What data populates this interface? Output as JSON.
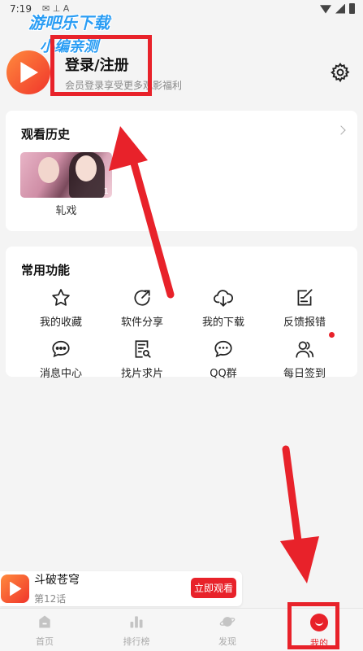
{
  "status_bar": {
    "time": "7:19",
    "icons": "✉ ⊥ A"
  },
  "watermark": {
    "line1": "游吧乐下载",
    "line2": "小编亲测"
  },
  "profile": {
    "login_title": "登录/注册",
    "login_subtitle": "会员登录享受更多观影福利"
  },
  "history": {
    "title": "观看历史",
    "items": [
      {
        "name": "轧戏",
        "episode": "1"
      }
    ]
  },
  "functions": {
    "title": "常用功能",
    "items": [
      {
        "label": "我的收藏",
        "icon": "star-icon"
      },
      {
        "label": "软件分享",
        "icon": "share-icon"
      },
      {
        "label": "我的下载",
        "icon": "cloud-download-icon"
      },
      {
        "label": "反馈报错",
        "icon": "edit-icon"
      },
      {
        "label": "消息中心",
        "icon": "message-icon"
      },
      {
        "label": "找片求片",
        "icon": "search-doc-icon"
      },
      {
        "label": "QQ群",
        "icon": "chat-icon"
      },
      {
        "label": "每日签到",
        "icon": "users-icon"
      }
    ]
  },
  "mini_player": {
    "title": "斗破苍穹",
    "episode": "第12话",
    "button": "立即观看"
  },
  "tabs": [
    {
      "label": "首页",
      "icon": "home-icon"
    },
    {
      "label": "排行榜",
      "icon": "bar-chart-icon"
    },
    {
      "label": "发现",
      "icon": "planet-icon"
    },
    {
      "label": "我的",
      "icon": "mine-icon",
      "active": true
    }
  ],
  "colors": {
    "accent": "#e8222a",
    "watermark": "#2a9df4"
  }
}
